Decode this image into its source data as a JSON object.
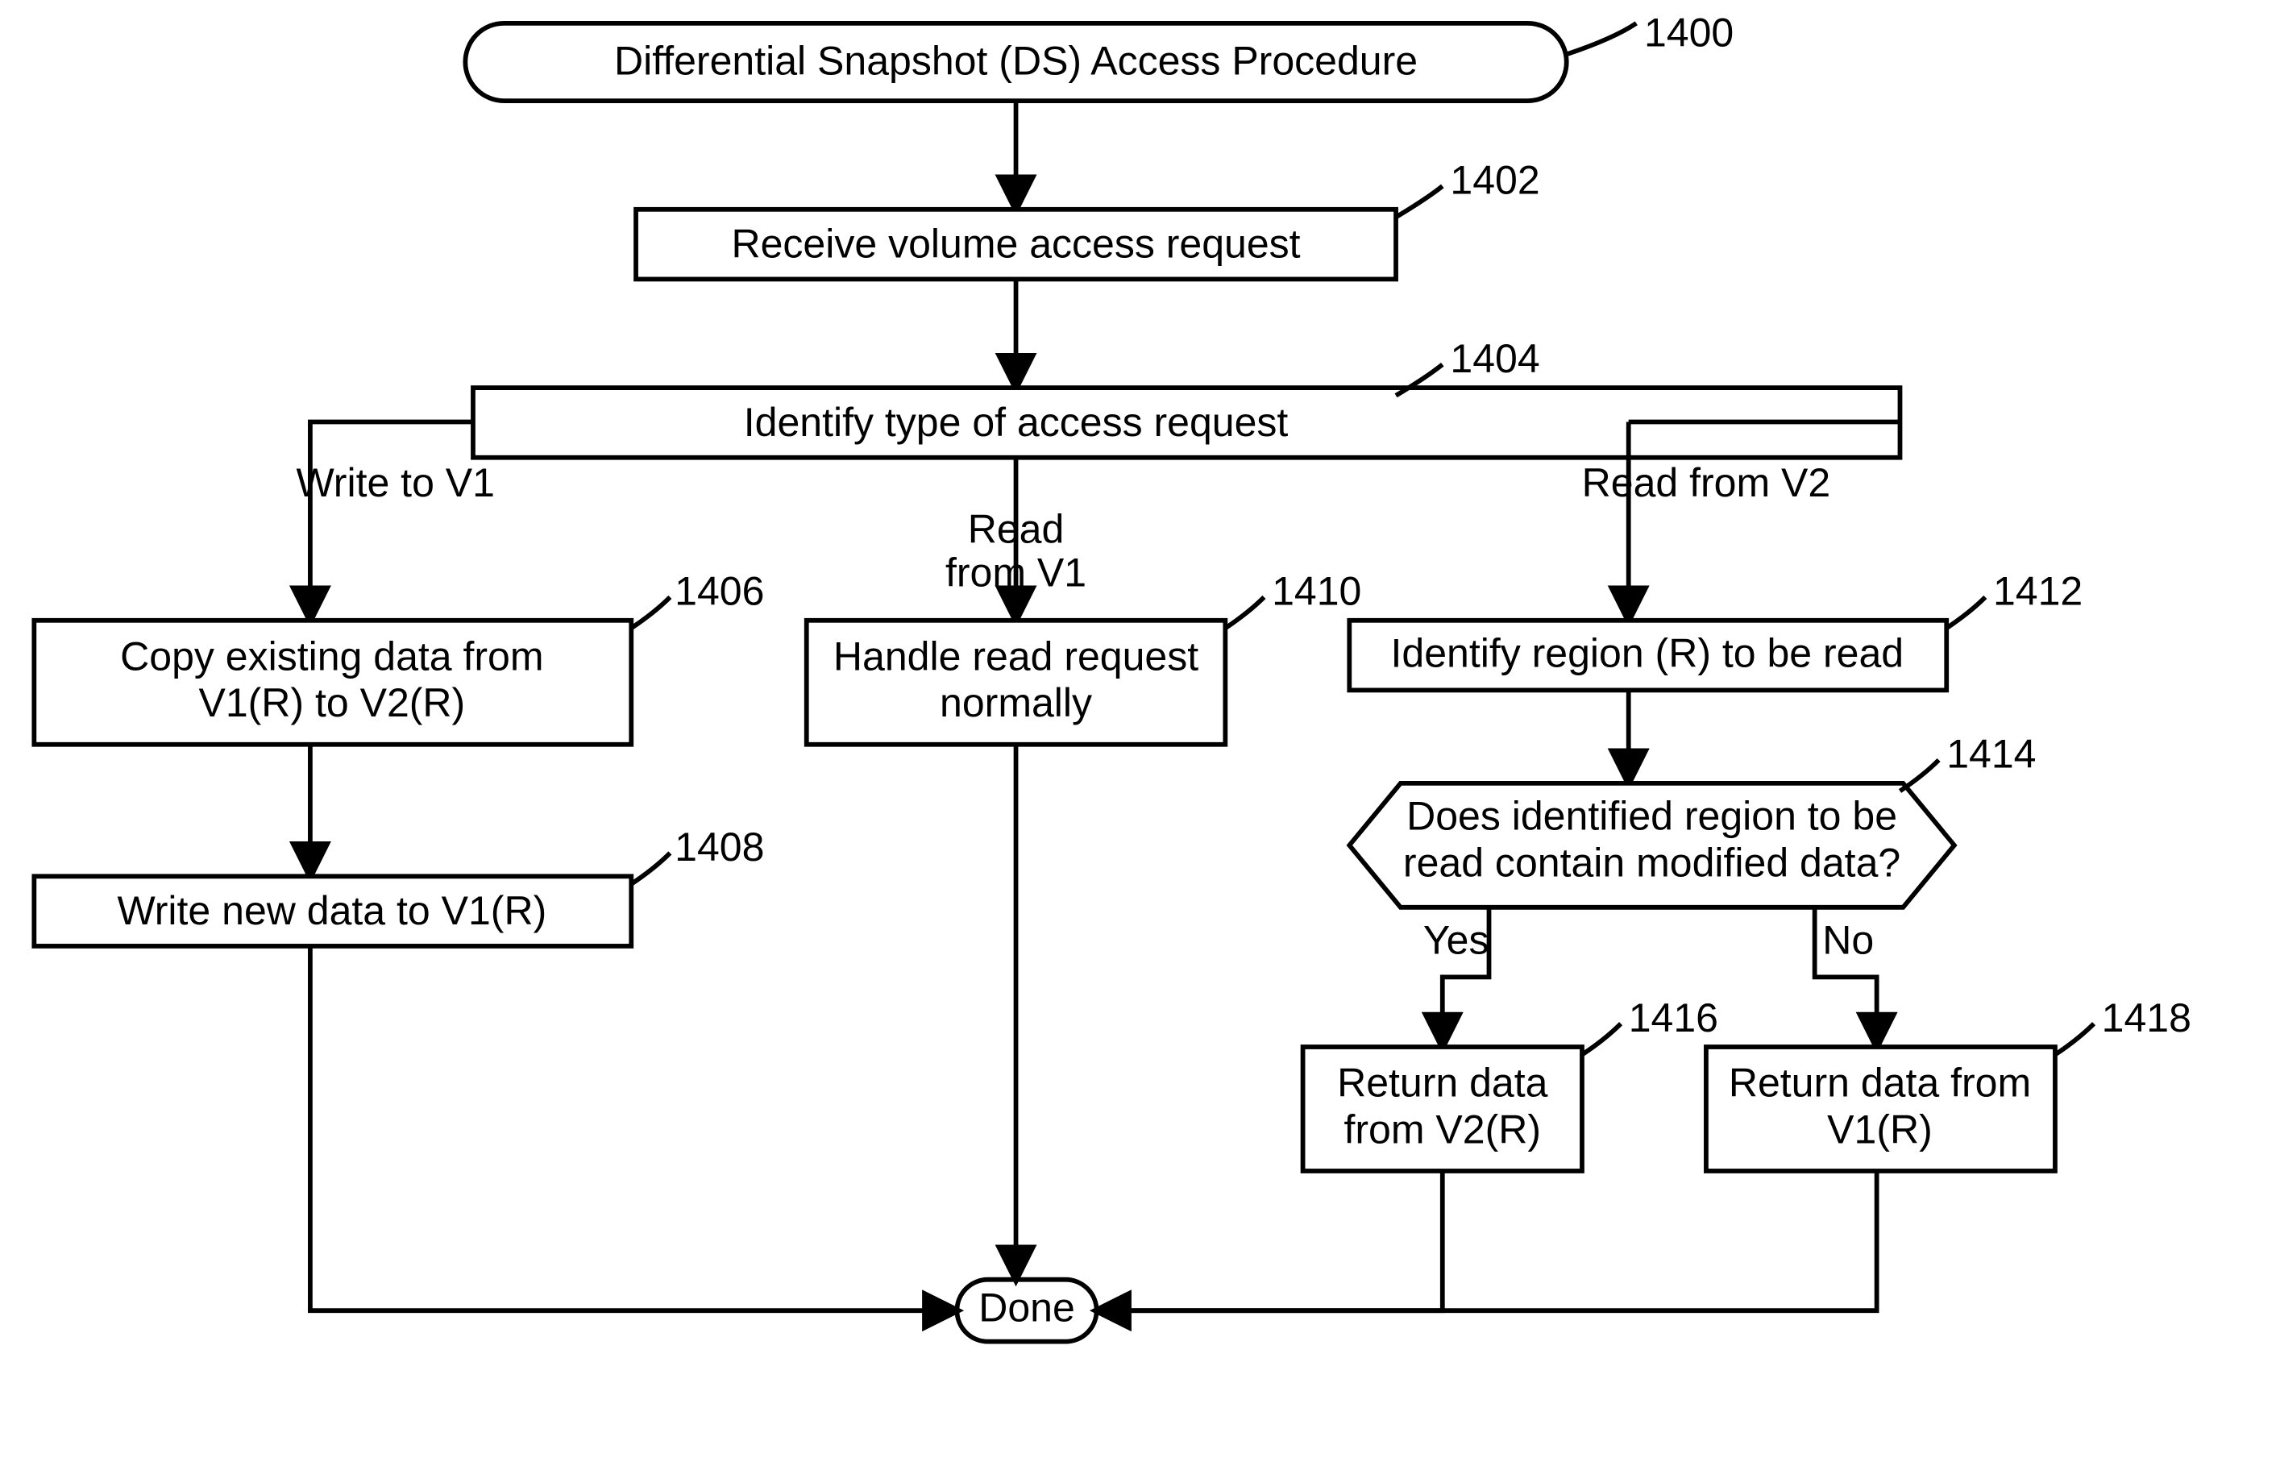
{
  "nodes": {
    "n1400": {
      "text": "Differential Snapshot (DS) Access Procedure",
      "ref": "1400"
    },
    "n1402": {
      "text": "Receive volume access request",
      "ref": "1402"
    },
    "n1404": {
      "text": "Identify type of access request",
      "ref": "1404"
    },
    "n1406": {
      "line1": "Copy existing data from",
      "line2": "V1(R) to V2(R)",
      "ref": "1406"
    },
    "n1408": {
      "text": "Write new data to V1(R)",
      "ref": "1408"
    },
    "n1410": {
      "line1": "Handle read request",
      "line2": "normally",
      "ref": "1410"
    },
    "n1412": {
      "text": "Identify region (R) to be read",
      "ref": "1412"
    },
    "n1414": {
      "line1": "Does identified region to be",
      "line2": "read contain modified data?",
      "ref": "1414"
    },
    "n1416": {
      "line1": "Return data",
      "line2": "from V2(R)",
      "ref": "1416"
    },
    "n1418": {
      "line1": "Return data from",
      "line2": "V1(R)",
      "ref": "1418"
    },
    "done": {
      "text": "Done"
    }
  },
  "labels": {
    "writeV1": "Write to V1",
    "readV1a": "Read",
    "readV1b": "from V1",
    "readV2": "Read from V2",
    "yes": "Yes",
    "no": "No"
  }
}
